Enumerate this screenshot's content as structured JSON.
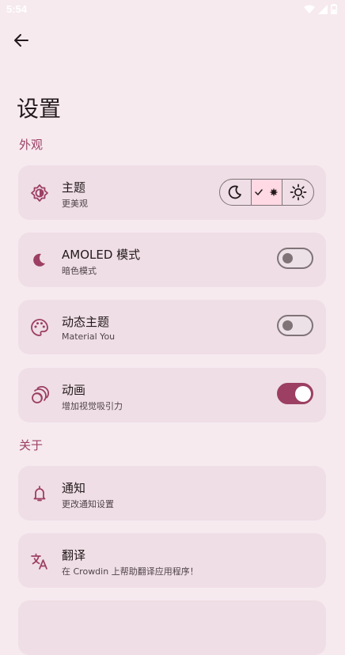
{
  "status_bar": {
    "time": "5:54"
  },
  "header": {
    "title": "设置"
  },
  "sections": {
    "appearance": "外观",
    "about": "关于"
  },
  "settings": {
    "theme": {
      "title": "主题",
      "subtitle": "更美观"
    },
    "amoled": {
      "title": "AMOLED 模式",
      "subtitle": "暗色模式",
      "enabled": false
    },
    "dynamic": {
      "title": "动态主题",
      "subtitle": "Material You",
      "enabled": false
    },
    "animation": {
      "title": "动画",
      "subtitle": "增加视觉吸引力",
      "enabled": true
    },
    "notify": {
      "title": "通知",
      "subtitle": "更改通知设置"
    },
    "translate": {
      "title": "翻译",
      "subtitle": "在 Crowdin 上帮助翻译应用程序！"
    }
  },
  "theme_options": [
    "dark-moon-icon",
    "auto-check-icon",
    "light-sun-icon"
  ],
  "colors": {
    "accent": "#9c3f63",
    "background": "#f6eaef",
    "card": "#efdee5"
  }
}
